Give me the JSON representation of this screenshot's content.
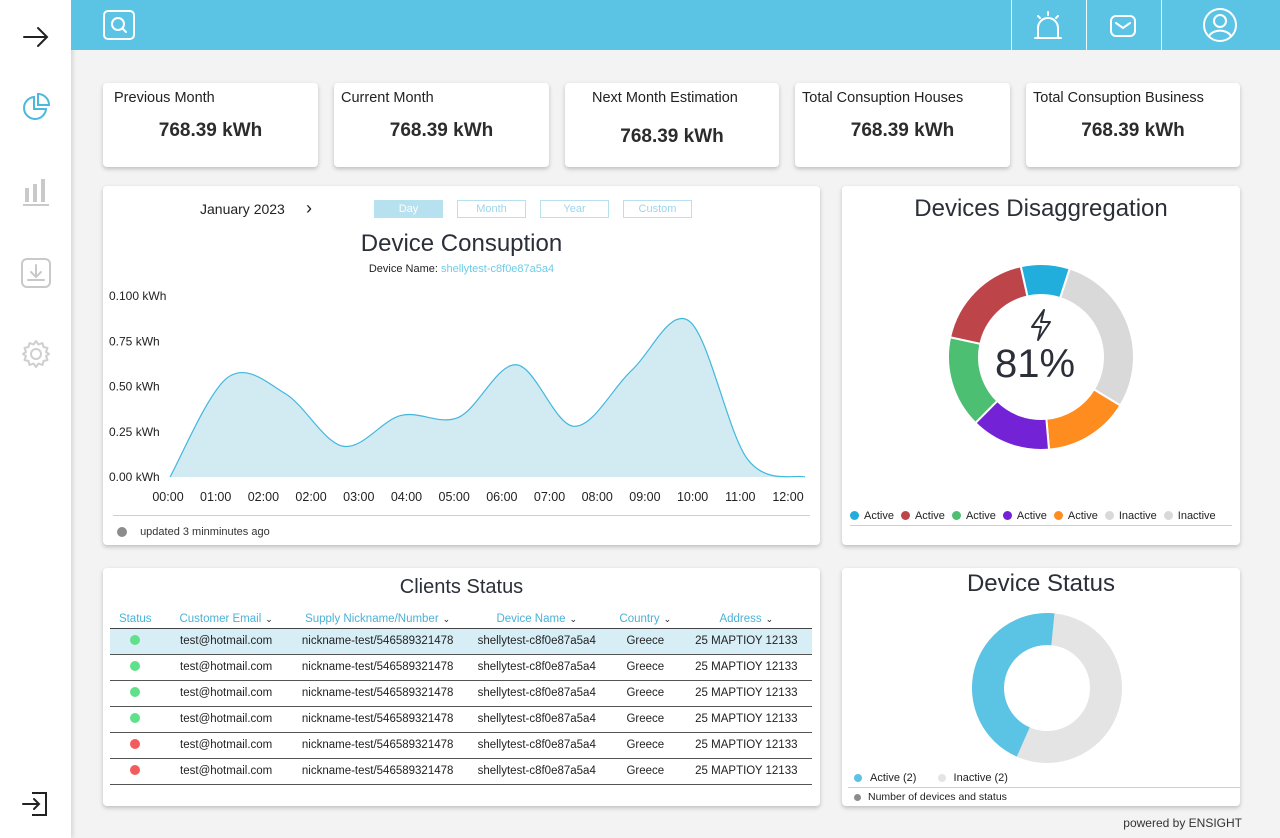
{
  "sidebar": {
    "icons": [
      "arrow-right-icon",
      "pie-chart-icon",
      "bar-chart-icon",
      "download-icon",
      "gear-icon",
      "logout-icon"
    ]
  },
  "topbar": {
    "icons": [
      "search-icon",
      "alarm-icon",
      "mail-icon",
      "user-icon"
    ]
  },
  "stats": [
    {
      "label": "Previous Month",
      "value": "768.39 kWh"
    },
    {
      "label": "Current Month",
      "value": "768.39 kWh"
    },
    {
      "label": "Next Month Estimation",
      "value": "768.39 kWh"
    },
    {
      "label": "Total Consuption Houses",
      "value": "768.39 kWh"
    },
    {
      "label": "Total Consuption Business",
      "value": "768.39 kWh"
    }
  ],
  "consumption": {
    "period": "January 2023",
    "ranges": [
      "Day",
      "Month",
      "Year",
      "Custom"
    ],
    "active_range": "Day",
    "title": "Device Consuption",
    "device_label": "Device Name:",
    "device_name": "shellytest-c8f0e87a5a4",
    "updated": "updated 3 minminutes ago"
  },
  "chart_data": {
    "type": "area",
    "title": "Device Consuption",
    "x": [
      "00:00",
      "01:00",
      "02:00",
      "02:00",
      "03:00",
      "04:00",
      "05:00",
      "06:00",
      "07:00",
      "08:00",
      "09:00",
      "10:00",
      "11:00",
      "12:00"
    ],
    "y_ticks": [
      "0.100 kWh",
      "0.75 kWh",
      "0.50 kWh",
      "0.25 kWh",
      "0.00 kWh"
    ],
    "series": [
      {
        "values": [
          0.0,
          0.55,
          0.46,
          0.17,
          0.34,
          0.33,
          0.62,
          0.28,
          0.59,
          0.86,
          0.1,
          0.0
        ]
      }
    ],
    "ylim": [
      0,
      1.0
    ]
  },
  "disaggregation": {
    "title": "Devices Disaggregation",
    "center_value": "81%",
    "segments": [
      {
        "label": "Active",
        "value": 8,
        "color": "#22aedc"
      },
      {
        "label": "Inactive",
        "value": 27,
        "color": "#d9d9d9"
      },
      {
        "label": "Active",
        "value": 14,
        "color": "#ff8c1f"
      },
      {
        "label": "Active",
        "value": 13,
        "color": "#7422d6"
      },
      {
        "label": "Active",
        "value": 15,
        "color": "#4cbf72"
      },
      {
        "label": "Active",
        "value": 17,
        "color": "#bd4448"
      }
    ],
    "legend": [
      {
        "label": "Active",
        "color": "#22aedc"
      },
      {
        "label": "Active",
        "color": "#bd4448"
      },
      {
        "label": "Active",
        "color": "#4cbf72"
      },
      {
        "label": "Active",
        "color": "#7422d6"
      },
      {
        "label": "Active",
        "color": "#ff8c1f"
      },
      {
        "label": "Inactive",
        "color": "#d9d9d9"
      },
      {
        "label": "Inactive",
        "color": "#d9d9d9"
      }
    ]
  },
  "clients": {
    "title": "Clients Status",
    "columns": [
      "Status",
      "Customer Email",
      "Supply Nickname/Number",
      "Device Name",
      "Country",
      "Address"
    ],
    "rows": [
      {
        "status": "green",
        "email": "test@hotmail.com",
        "supply": "nickname-test/546589321478",
        "device": "shellytest-c8f0e87a5a4",
        "country": "Greece",
        "address": "25 ΜΑΡΤΙΟΥ 12133"
      },
      {
        "status": "green",
        "email": "test@hotmail.com",
        "supply": "nickname-test/546589321478",
        "device": "shellytest-c8f0e87a5a4",
        "country": "Greece",
        "address": "25 ΜΑΡΤΙΟΥ 12133"
      },
      {
        "status": "green",
        "email": "test@hotmail.com",
        "supply": "nickname-test/546589321478",
        "device": "shellytest-c8f0e87a5a4",
        "country": "Greece",
        "address": "25 ΜΑΡΤΙΟΥ 12133"
      },
      {
        "status": "green",
        "email": "test@hotmail.com",
        "supply": "nickname-test/546589321478",
        "device": "shellytest-c8f0e87a5a4",
        "country": "Greece",
        "address": "25 ΜΑΡΤΙΟΥ 12133"
      },
      {
        "status": "red",
        "email": "test@hotmail.com",
        "supply": "nickname-test/546589321478",
        "device": "shellytest-c8f0e87a5a4",
        "country": "Greece",
        "address": "25 ΜΑΡΤΙΟΥ 12133"
      },
      {
        "status": "red",
        "email": "test@hotmail.com",
        "supply": "nickname-test/546589321478",
        "device": "shellytest-c8f0e87a5a4",
        "country": "Greece",
        "address": "25 ΜΑΡΤΙΟΥ 12133"
      }
    ],
    "status_colors": {
      "green": "#5fe08a",
      "red": "#f25c5c"
    }
  },
  "device_status": {
    "title": "Device Status",
    "active": 2,
    "inactive": 2,
    "active_label": "Active (2)",
    "inactive_label": "Inactive (2)",
    "active_fraction": 0.45,
    "active_color": "#5bc4e5",
    "inactive_color": "#e4e4e4",
    "footnote": "Number of devices and status"
  },
  "footer": "powered by ENSIGHT"
}
